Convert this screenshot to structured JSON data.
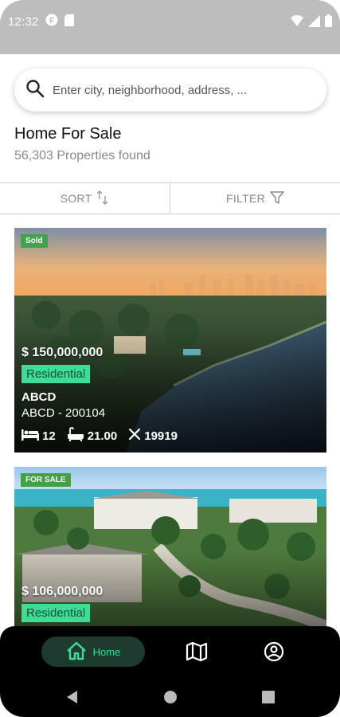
{
  "status_bar": {
    "time": "12:32",
    "icons": [
      "notification-f-icon",
      "sd-card-icon",
      "wifi-icon",
      "signal-icon",
      "battery-icon"
    ]
  },
  "search": {
    "placeholder": "Enter city, neighborhood, address, ..."
  },
  "header": {
    "title": "Home For Sale",
    "subtitle": "56,303 Properties found"
  },
  "toolbar": {
    "sort_label": "SORT",
    "filter_label": "FILTER"
  },
  "listings": [
    {
      "status": "Sold",
      "price": "$ 150,000,000",
      "type": "Residential",
      "name": "ABCD",
      "code": "ABCD - 200104",
      "beds": "12",
      "baths": "21.00",
      "area": "19919"
    },
    {
      "status": "FOR SALE",
      "price": "$ 106,000,000",
      "type": "Residential"
    }
  ],
  "bottom_nav": {
    "home_label": "Home",
    "items": [
      "home-icon",
      "map-icon",
      "profile-icon"
    ]
  },
  "colors": {
    "accent": "#3ddc97",
    "nav_active_bg": "#1e3b30",
    "sold_tag": "#3fa34d",
    "status_bar": "#bdbdbd"
  }
}
